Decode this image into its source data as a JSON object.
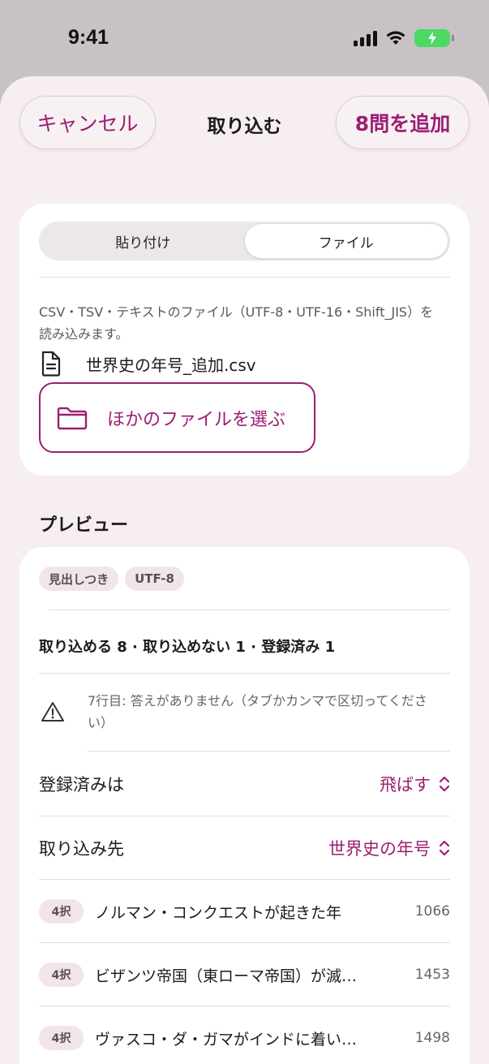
{
  "status_bar": {
    "time": "9:41"
  },
  "nav": {
    "cancel_label": "キャンセル",
    "title": "取り込む",
    "add_label": "8問を追加"
  },
  "source": {
    "tabs": [
      {
        "label": "貼り付け",
        "active": false
      },
      {
        "label": "ファイル",
        "active": true
      }
    ],
    "description": "CSV・TSV・テキストのファイル（UTF-8・UTF-16・Shift_JIS）を読み込みます。",
    "file_name": "世界史の年号_追加.csv",
    "choose_label": "ほかのファイルを選ぶ"
  },
  "preview": {
    "header": "プレビュー",
    "badges": [
      "見出しつき",
      "UTF-8"
    ],
    "summary": "取り込める 8 · 取り込めない 1 · 登録済み 1",
    "warning": "7行目: 答えがありません（タブかカンマで区切ってください）",
    "settings": [
      {
        "label": "登録済みは",
        "value": "飛ばす"
      },
      {
        "label": "取り込み先",
        "value": "世界史の年号"
      }
    ],
    "questions": [
      {
        "type": "4択",
        "text": "ノルマン・コンクエストが起きた年",
        "answer": "1066"
      },
      {
        "type": "4択",
        "text": "ビザンツ帝国（東ローマ帝国）が滅…",
        "answer": "1453"
      },
      {
        "type": "4択",
        "text": "ヴァスコ・ダ・ガマがインドに着い…",
        "answer": "1498"
      }
    ]
  },
  "colors": {
    "accent": "#9b1f72",
    "sheet_background": "#f6eef1",
    "battery": "#4cd964"
  }
}
